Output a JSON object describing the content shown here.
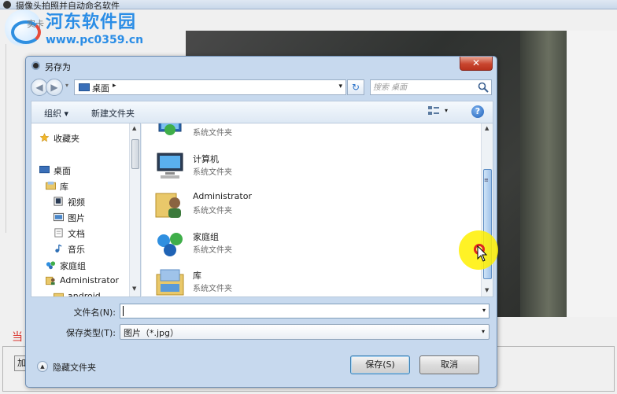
{
  "app": {
    "title": "摄像头拍照并自动命名软件",
    "status_text": "当",
    "bottom_button": "加"
  },
  "watermark": {
    "name": "河东软件园",
    "url": "www.pc0359.cn",
    "sub": "实卡"
  },
  "dialog": {
    "title": "另存为",
    "close_label": "✕",
    "address": {
      "location": "桌面",
      "separator": "▸",
      "dropdown": "▾",
      "refresh": "↻"
    },
    "search": {
      "placeholder": "搜索 桌面"
    },
    "toolbar": {
      "organize": "组织 ▾",
      "new_folder": "新建文件夹",
      "view_drop": "▾",
      "help": "?"
    },
    "nav_items": [
      {
        "label": "收藏夹",
        "icon": "star-icon"
      },
      {
        "label": "桌面",
        "icon": "desktop-icon"
      },
      {
        "label": "库",
        "icon": "library-icon"
      },
      {
        "label": "视频",
        "icon": "video-icon"
      },
      {
        "label": "图片",
        "icon": "picture-icon"
      },
      {
        "label": "文档",
        "icon": "document-icon"
      },
      {
        "label": "音乐",
        "icon": "music-icon"
      },
      {
        "label": "家庭组",
        "icon": "homegroup-icon"
      },
      {
        "label": "Administrator",
        "icon": "user-icon"
      },
      {
        "label": "android",
        "icon": "folder-icon"
      }
    ],
    "files": [
      {
        "name": "",
        "type": "系统文件夹",
        "icon": "network-icon"
      },
      {
        "name": "计算机",
        "type": "系统文件夹",
        "icon": "computer-icon"
      },
      {
        "name": "Administrator",
        "type": "系统文件夹",
        "icon": "user-folder-icon"
      },
      {
        "name": "家庭组",
        "type": "系统文件夹",
        "icon": "homegroup-icon"
      },
      {
        "name": "库",
        "type": "系统文件夹",
        "icon": "library-icon"
      }
    ],
    "form": {
      "filename_label": "文件名(N):",
      "filename_value": "",
      "filetype_label": "保存类型(T):",
      "filetype_value": "图片（*.jpg）",
      "dropdown": "▾"
    },
    "footer": {
      "hide_folders": "隐藏文件夹",
      "save": "保存(S)",
      "cancel": "取消"
    }
  }
}
